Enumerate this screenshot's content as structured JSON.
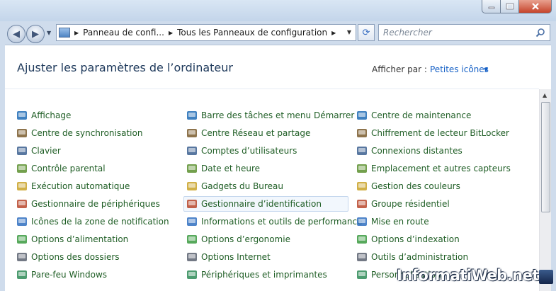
{
  "window": {
    "address": {
      "segment_1": "Panneau de confi...",
      "segment_2": "Tous les Panneaux de configuration"
    },
    "search_placeholder": "Rechercher"
  },
  "content": {
    "heading": "Ajuster les paramètres de l’ordinateur",
    "view_by_label": "Afficher par :",
    "view_by_value": "Petites icônes"
  },
  "items": {
    "col1": [
      {
        "label": "Affichage",
        "icon": "display-icon"
      },
      {
        "label": "Centre de synchronisation",
        "icon": "sync-center-icon"
      },
      {
        "label": "Clavier",
        "icon": "keyboard-icon"
      },
      {
        "label": "Contrôle parental",
        "icon": "parental-control-icon"
      },
      {
        "label": "Exécution automatique",
        "icon": "autoplay-icon"
      },
      {
        "label": "Gestionnaire de périphériques",
        "icon": "device-manager-icon"
      },
      {
        "label": "Icônes de la zone de notification",
        "icon": "notification-area-icon"
      },
      {
        "label": "Options d’alimentation",
        "icon": "power-options-icon"
      },
      {
        "label": "Options des dossiers",
        "icon": "folder-options-icon"
      },
      {
        "label": "Pare-feu Windows",
        "icon": "firewall-icon"
      }
    ],
    "col2": [
      {
        "label": "Barre des tâches et menu Démarrer",
        "icon": "taskbar-icon"
      },
      {
        "label": "Centre Réseau et partage",
        "icon": "network-center-icon"
      },
      {
        "label": "Comptes d’utilisateurs",
        "icon": "user-accounts-icon"
      },
      {
        "label": "Date et heure",
        "icon": "date-time-icon"
      },
      {
        "label": "Gadgets du Bureau",
        "icon": "gadgets-icon"
      },
      {
        "label": "Gestionnaire d’identification",
        "icon": "credential-manager-icon"
      },
      {
        "label": "Informations et outils de performance",
        "icon": "performance-icon"
      },
      {
        "label": "Options d’ergonomie",
        "icon": "ease-of-access-icon"
      },
      {
        "label": "Options Internet",
        "icon": "internet-options-icon"
      },
      {
        "label": "Périphériques et imprimantes",
        "icon": "printers-icon"
      }
    ],
    "col3": [
      {
        "label": "Centre de maintenance",
        "icon": "action-center-flag-icon"
      },
      {
        "label": "Chiffrement de lecteur BitLocker",
        "icon": "bitlocker-icon"
      },
      {
        "label": "Connexions distantes",
        "icon": "remote-connections-icon"
      },
      {
        "label": "Emplacement et autres capteurs",
        "icon": "location-sensors-icon"
      },
      {
        "label": "Gestion des couleurs",
        "icon": "color-management-icon"
      },
      {
        "label": "Groupe résidentiel",
        "icon": "homegroup-icon"
      },
      {
        "label": "Mise en route",
        "icon": "getting-started-icon"
      },
      {
        "label": "Options d’indexation",
        "icon": "indexing-icon"
      },
      {
        "label": "Outils d’administration",
        "icon": "admin-tools-icon"
      },
      {
        "label": "Personnalisation",
        "icon": "personalization-icon"
      }
    ]
  },
  "selected_item": "Gestionnaire d’identification",
  "watermark": "InformatiWeb.net",
  "colors": {
    "link_green": "#1e5d24",
    "heading_blue": "#1e395b",
    "accent_blue": "#1560c6"
  }
}
